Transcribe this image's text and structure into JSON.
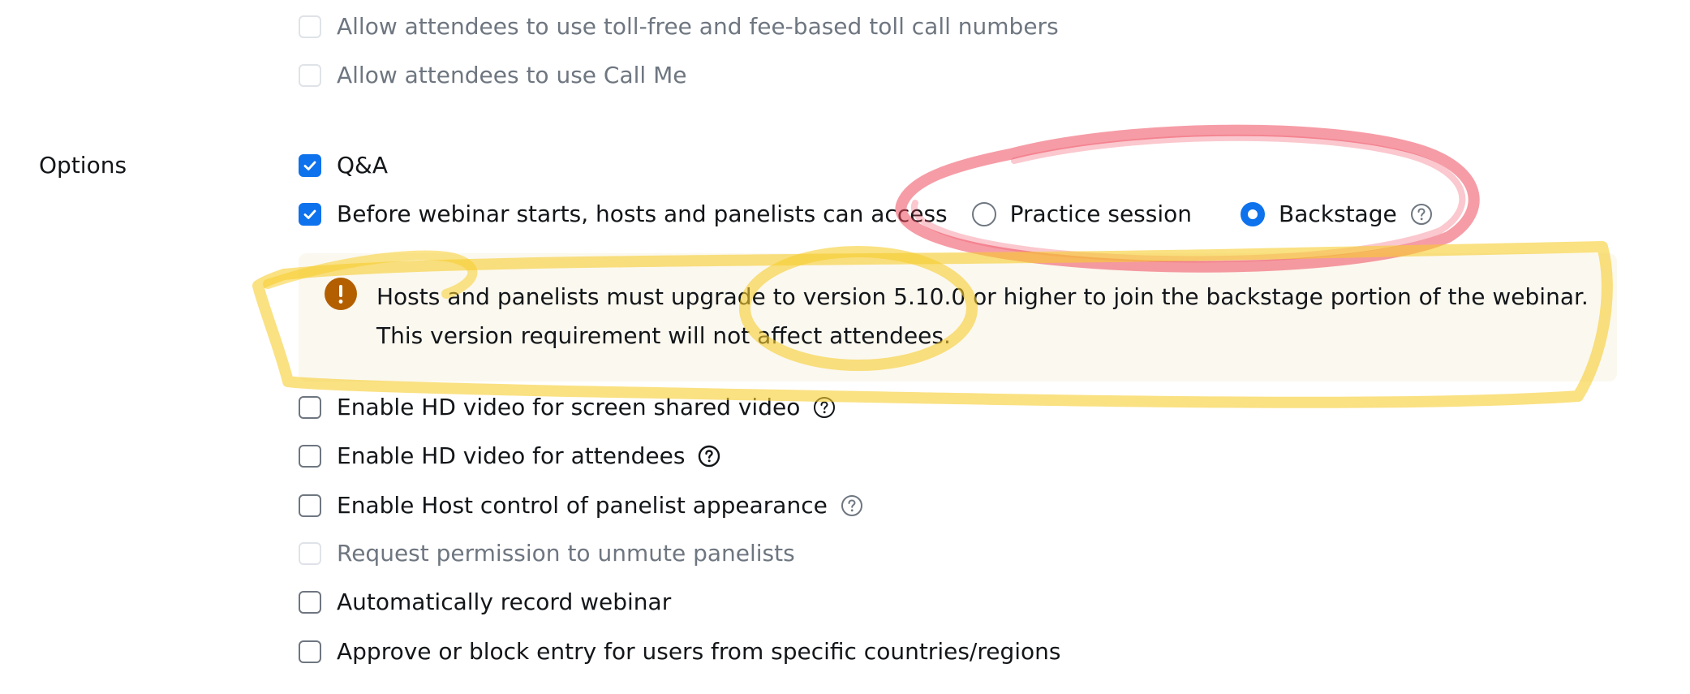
{
  "audio_options": {
    "toll_free": "Allow attendees to use toll-free and fee-based toll call numbers",
    "call_me": "Allow attendees to use Call Me"
  },
  "options": {
    "section_label": "Options",
    "qa": "Q&A",
    "before_webinar": "Before webinar starts, hosts and panelists can access",
    "practice_session": "Practice session",
    "backstage": "Backstage",
    "notice_line1": "Hosts and panelists must upgrade to version 5.10.0 or higher to join the backstage portion of the webinar.",
    "notice_line2": "This version requirement will not affect attendees.",
    "hd_screen_share": "Enable HD video for screen shared video",
    "hd_attendees": "Enable HD video for attendees",
    "host_control_panelist": "Enable Host control of panelist appearance",
    "request_unmute": "Request permission to unmute panelists",
    "auto_record": "Automatically record webinar",
    "approve_block_entry": "Approve or block entry for users from specific countries/regions"
  },
  "colors": {
    "accent": "#0e72ed",
    "warning": "#b35f00",
    "notice_bg": "#fbf8ef",
    "annotation_red": "#ef4a5c",
    "annotation_yellow": "#f7cd2e"
  }
}
